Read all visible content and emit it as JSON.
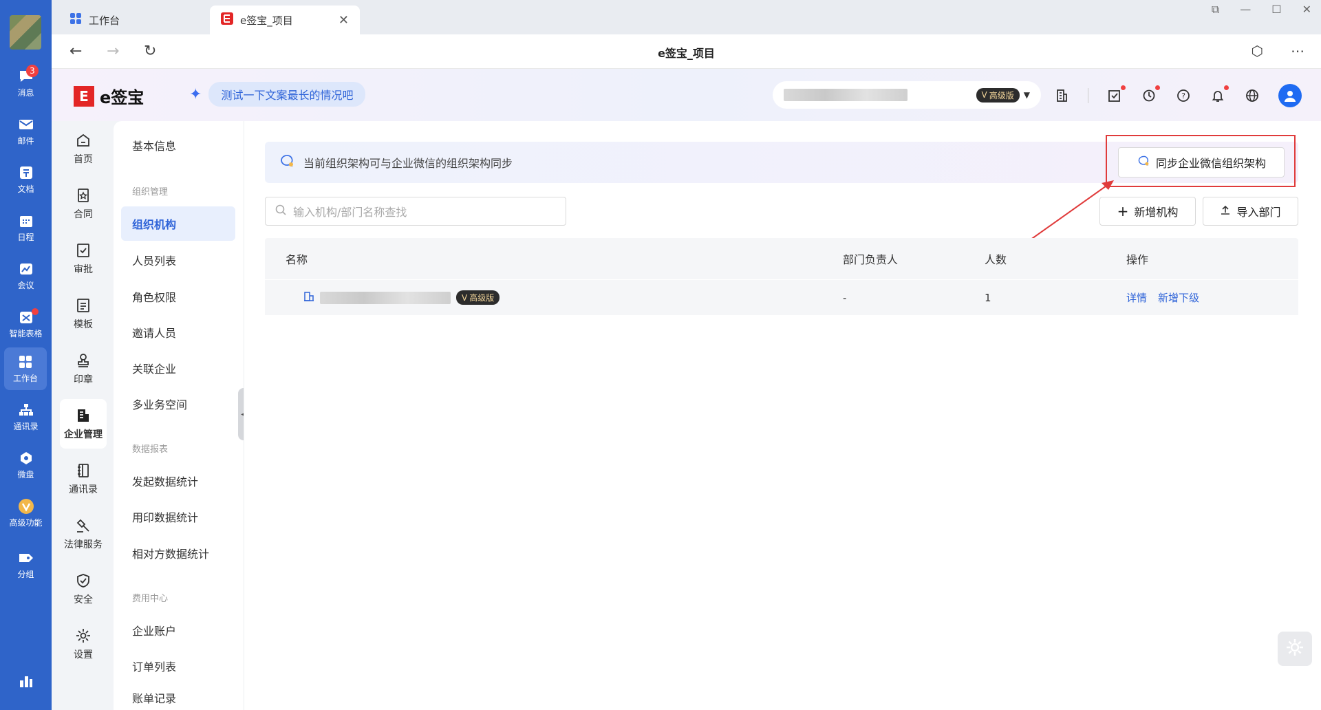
{
  "rail": {
    "items": [
      {
        "label": "消息",
        "icon": "chat-icon",
        "badge": "3"
      },
      {
        "label": "邮件",
        "icon": "mail-icon"
      },
      {
        "label": "文档",
        "icon": "doc-icon"
      },
      {
        "label": "日程",
        "icon": "calendar-icon"
      },
      {
        "label": "会议",
        "icon": "meeting-icon"
      },
      {
        "label": "智能表格",
        "icon": "sheet-icon"
      },
      {
        "label": "工作台",
        "icon": "grid-icon"
      },
      {
        "label": "通讯录",
        "icon": "org-icon"
      },
      {
        "label": "微盘",
        "icon": "drive-icon"
      },
      {
        "label": "高级功能",
        "icon": "premium-icon"
      },
      {
        "label": "分组",
        "icon": "tag-icon"
      }
    ]
  },
  "tabs": [
    {
      "label": "工作台",
      "icon": "grid-icon"
    },
    {
      "label": "e签宝_项目",
      "icon": "esign-icon"
    }
  ],
  "navbar": {
    "title": "e签宝_项目"
  },
  "header": {
    "logo_text": "e签宝",
    "ai_prompt": "测试一下文案最长的情况吧",
    "org_badge": "高级版"
  },
  "side_nav": [
    {
      "label": "首页",
      "icon": "home-icon"
    },
    {
      "label": "合同",
      "icon": "contract-icon"
    },
    {
      "label": "审批",
      "icon": "approve-icon"
    },
    {
      "label": "模板",
      "icon": "template-icon"
    },
    {
      "label": "印章",
      "icon": "seal-icon"
    },
    {
      "label": "企业管理",
      "icon": "building-icon"
    },
    {
      "label": "通讯录",
      "icon": "contacts-icon"
    },
    {
      "label": "法律服务",
      "icon": "gavel-icon"
    },
    {
      "label": "安全",
      "icon": "shield-icon"
    },
    {
      "label": "设置",
      "icon": "gear-icon"
    }
  ],
  "submenu": {
    "basic": "基本信息",
    "group_org": "组织管理",
    "org_items": [
      "组织机构",
      "人员列表",
      "角色权限",
      "邀请人员",
      "关联企业",
      "多业务空间"
    ],
    "group_data": "数据报表",
    "data_items": [
      "发起数据统计",
      "用印数据统计",
      "相对方数据统计"
    ],
    "group_fee": "费用中心",
    "fee_items": [
      "企业账户",
      "订单列表",
      "账单记录"
    ]
  },
  "main": {
    "banner_text": "当前组织架构可与企业微信的组织架构同步",
    "sync_button": "同步企业微信组织架构",
    "search_placeholder": "输入机构/部门名称查找",
    "add_org_button": "新增机构",
    "import_button": "导入部门",
    "table": {
      "headers": [
        "名称",
        "部门负责人",
        "人数",
        "操作"
      ],
      "rows": [
        {
          "badge": "高级版",
          "leader": "-",
          "count": "1",
          "actions": [
            "详情",
            "新增下级"
          ]
        }
      ]
    }
  },
  "colors": {
    "brand": "#2f64c9",
    "accent": "#2e63d8",
    "highlight": "#e03b3b",
    "logo_red": "#e32626"
  }
}
